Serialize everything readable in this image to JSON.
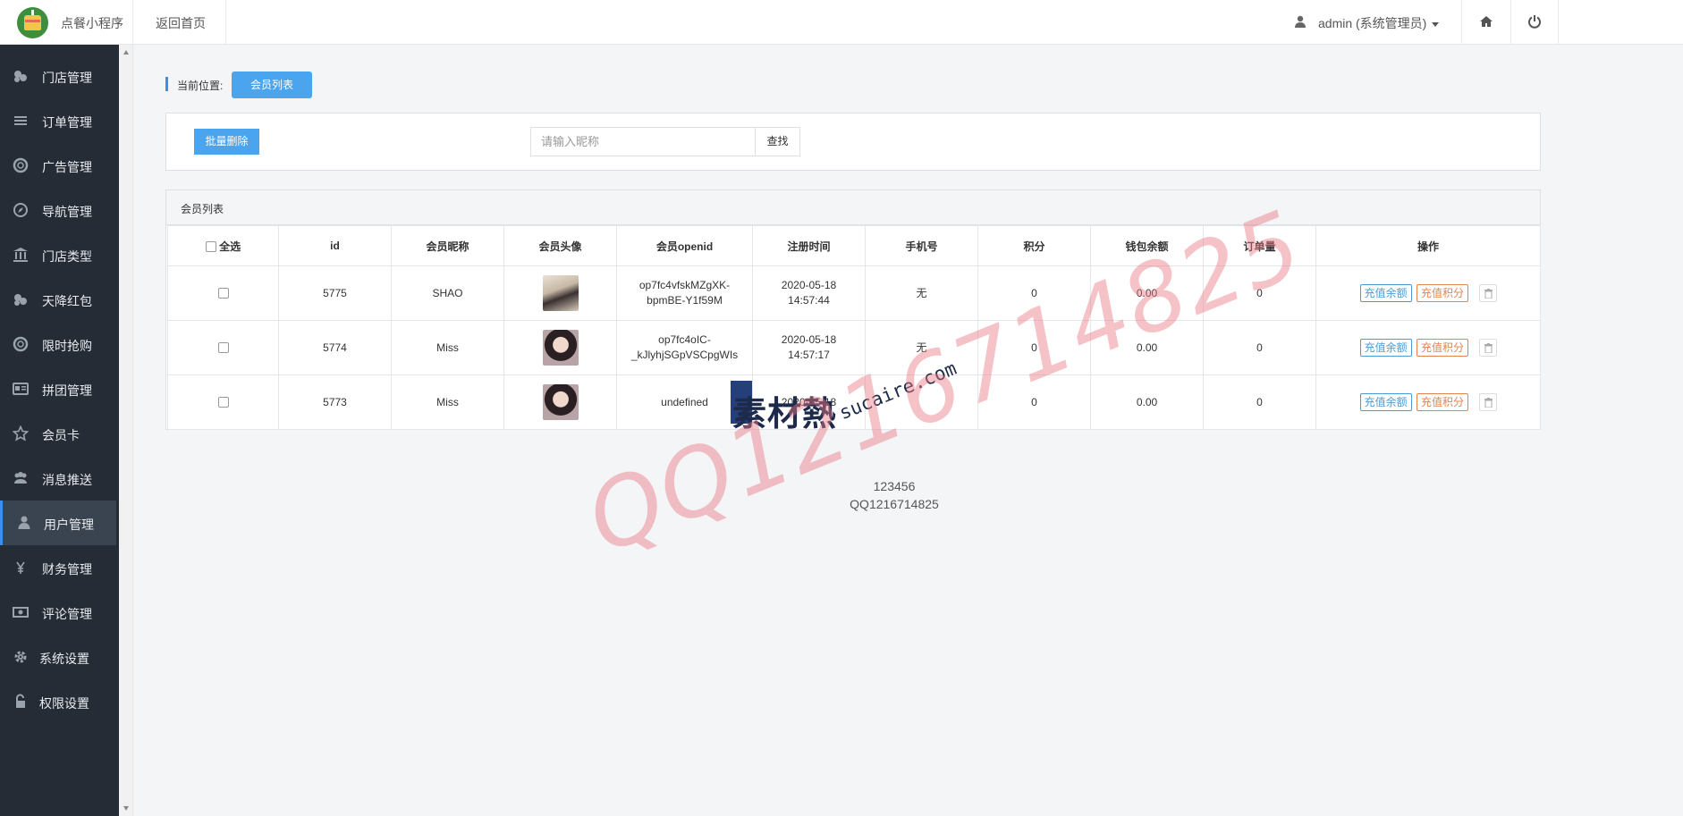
{
  "app": {
    "title": "点餐小程序",
    "home_link": "返回首页"
  },
  "user": {
    "name": "admin (系统管理员)"
  },
  "sidebar": {
    "items": [
      {
        "label": "门店管理",
        "icon": "store-icon"
      },
      {
        "label": "订单管理",
        "icon": "list-icon"
      },
      {
        "label": "广告管理",
        "icon": "lifebuoy-icon"
      },
      {
        "label": "导航管理",
        "icon": "compass-icon"
      },
      {
        "label": "门店类型",
        "icon": "bank-icon"
      },
      {
        "label": "天降红包",
        "icon": "coins-icon"
      },
      {
        "label": "限时抢购",
        "icon": "lifebuoy-icon"
      },
      {
        "label": "拼团管理",
        "icon": "id-card-icon"
      },
      {
        "label": "会员卡",
        "icon": "star-icon"
      },
      {
        "label": "消息推送",
        "icon": "users-icon"
      },
      {
        "label": "用户管理",
        "icon": "user-icon",
        "active": true
      },
      {
        "label": "财务管理",
        "icon": "yen-icon"
      },
      {
        "label": "评论管理",
        "icon": "money-icon"
      },
      {
        "label": "系统设置",
        "icon": "gear-icon"
      },
      {
        "label": "权限设置",
        "icon": "unlock-icon"
      }
    ]
  },
  "breadcrumb": {
    "label": "当前位置:",
    "current": "会员列表"
  },
  "toolbar": {
    "batch_delete": "批量删除",
    "search_placeholder": "请输入昵称",
    "search_button": "查找"
  },
  "member_panel": {
    "title": "会员列表",
    "select_all": "全选",
    "columns": [
      "id",
      "会员昵称",
      "会员头像",
      "会员openid",
      "注册时间",
      "手机号",
      "积分",
      "钱包余额",
      "订单量",
      "操作"
    ],
    "rows": [
      {
        "id": "5775",
        "nickname": "SHAO",
        "openid": "op7fc4vfskMZgXK-bpmBE-Y1f59M",
        "openid_l1": "op7fc4vfskMZgXK-",
        "openid_l2": "bpmBE-Y1f59M",
        "reg_date": "2020-05-18",
        "reg_time": "14:57:44",
        "phone": "无",
        "points": "0",
        "wallet": "0.00",
        "orders": "0"
      },
      {
        "id": "5774",
        "nickname": "Miss",
        "openid": "op7fc4oIC-_kJlyhjSGpVSCpgWIs",
        "openid_l1": "op7fc4oIC-",
        "openid_l2": "_kJlyhjSGpVSCpgWIs",
        "reg_date": "2020-05-18",
        "reg_time": "14:57:17",
        "phone": "无",
        "points": "0",
        "wallet": "0.00",
        "orders": "0"
      },
      {
        "id": "5773",
        "nickname": "Miss",
        "openid": "undefined",
        "openid_l1": "undefined",
        "openid_l2": "",
        "reg_date": "2020-05-18",
        "reg_time": "",
        "phone": "",
        "points": "0",
        "wallet": "0.00",
        "orders": "0"
      }
    ],
    "actions": {
      "recharge_balance": "充值余额",
      "recharge_points": "充值积分"
    }
  },
  "footer": {
    "code": "123456",
    "qq": "QQ1216714825"
  },
  "watermark": {
    "text": "QQ1216714825",
    "logo_zh": "素材熱",
    "logo_en": "sucaire.com"
  },
  "colors": {
    "accent": "#4aa4ee",
    "sidebar_bg": "#252c36",
    "active_bar": "#3d8ee8",
    "btn_blue": "#4a9bd6",
    "btn_orange": "#e0854d",
    "watermark": "#e87882"
  }
}
